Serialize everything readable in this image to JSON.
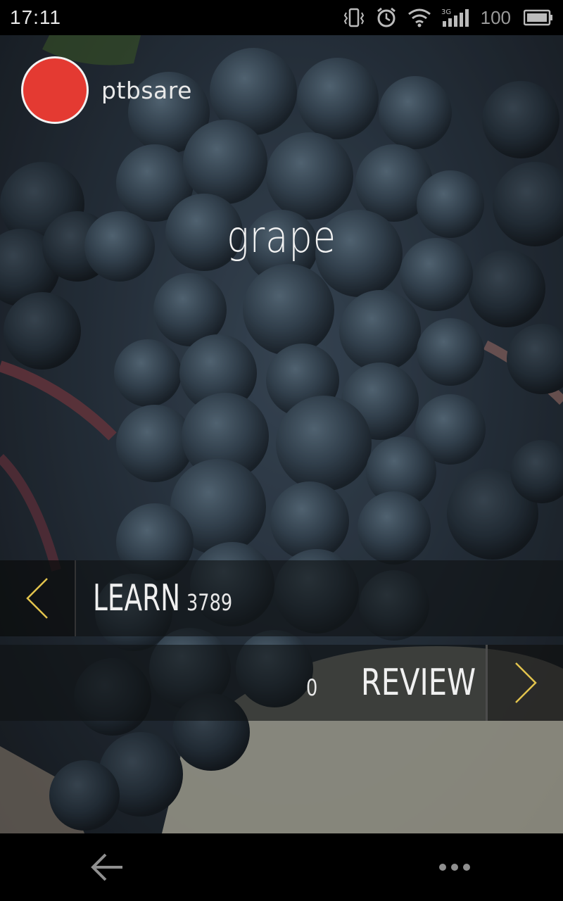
{
  "status_bar": {
    "time": "17:11",
    "battery_level": "100",
    "network": "3G",
    "icons": [
      "vibrate-icon",
      "alarm-icon",
      "wifi-icon",
      "signal-icon",
      "battery-icon"
    ]
  },
  "user": {
    "name": "ptbsare",
    "avatar_color": "#e43a32"
  },
  "card": {
    "word": "grape"
  },
  "learn": {
    "label": "LEARN",
    "count": "3789"
  },
  "review": {
    "label": "REVIEW",
    "count": "0"
  },
  "colors": {
    "accent_arrow": "#e2c34d"
  },
  "nav": {
    "icons": [
      "back-arrow-icon",
      "more-dots-icon"
    ]
  }
}
